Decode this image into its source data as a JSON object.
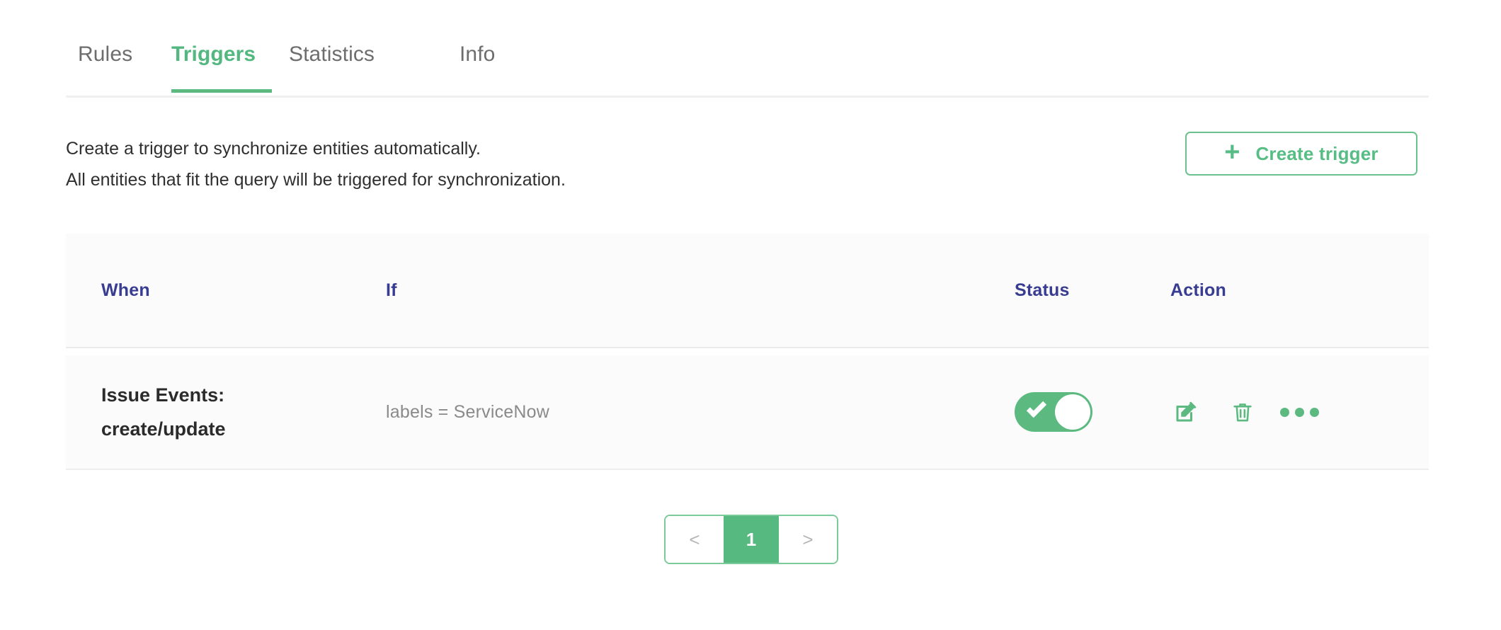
{
  "tabs": [
    {
      "label": "Rules",
      "active": false,
      "name": "tab-rules"
    },
    {
      "label": "Triggers",
      "active": true,
      "name": "tab-triggers"
    },
    {
      "label": "Statistics",
      "active": false,
      "name": "tab-statistics"
    },
    {
      "label": "Info",
      "active": false,
      "name": "tab-info"
    }
  ],
  "intro": {
    "line1": "Create a trigger to synchronize entities automatically.",
    "line2": "All entities that fit the query will be triggered for synchronization."
  },
  "create_button": {
    "label": "Create trigger",
    "plus_icon": "plus-icon"
  },
  "table": {
    "headers": {
      "when": "When",
      "if": "If",
      "status": "Status",
      "action": "Action"
    },
    "rows": [
      {
        "when_line1": "Issue Events:",
        "when_line2": "create/update",
        "if": "labels = ServiceNow",
        "status_enabled": true,
        "actions": [
          "edit-icon",
          "delete-icon",
          "more-icon"
        ]
      }
    ]
  },
  "pagination": {
    "prev": "<",
    "current": "1",
    "next": ">"
  },
  "colors": {
    "green": "#5cba81",
    "green_text": "#52b87f",
    "header_indigo": "#383d91",
    "row_bg": "#fbfbfb",
    "muted_text": "#8a8a8a"
  }
}
